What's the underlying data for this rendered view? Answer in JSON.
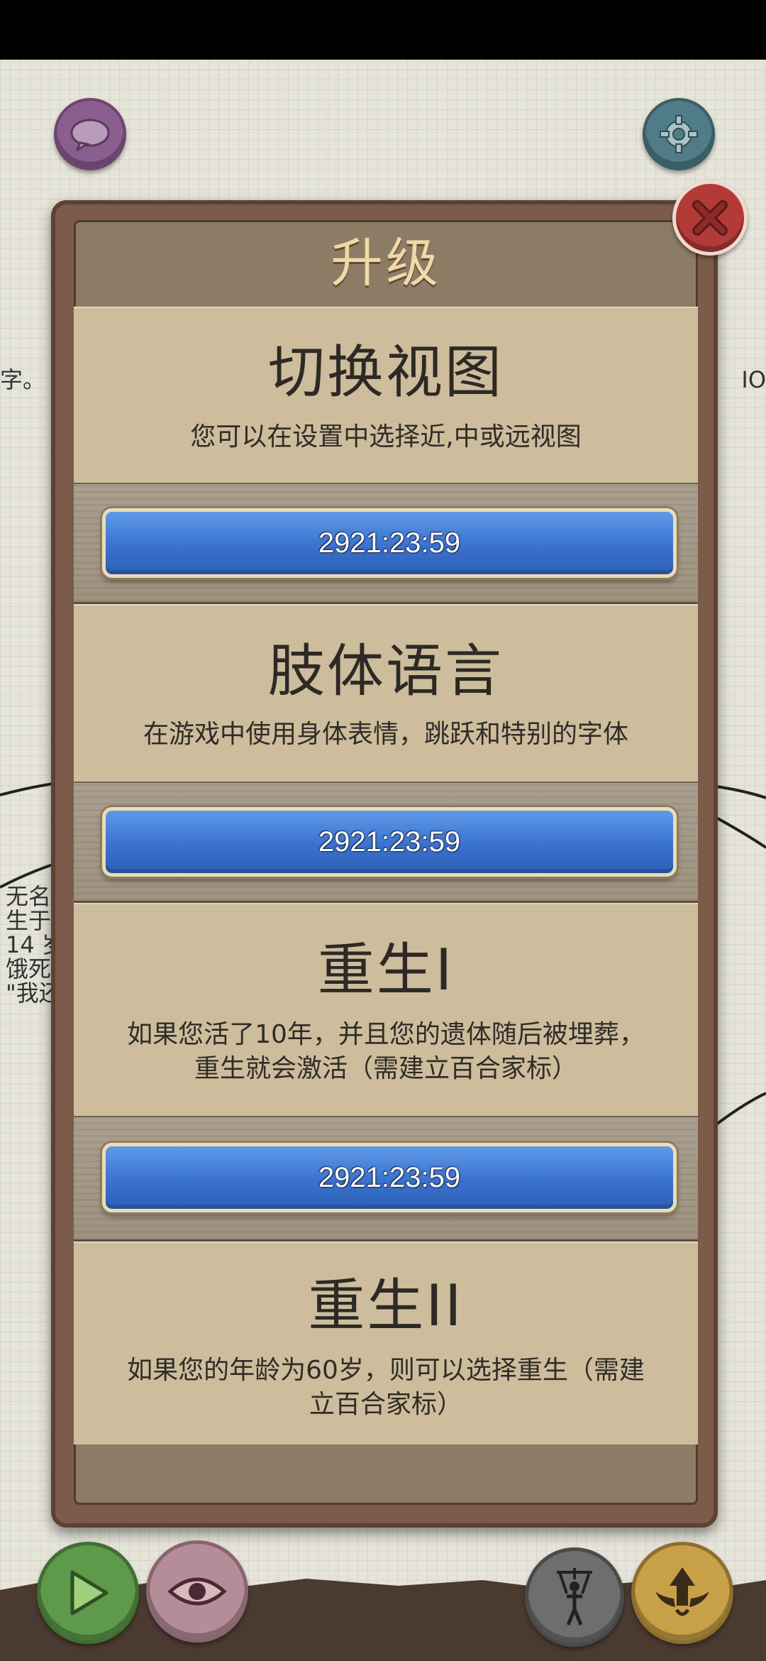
{
  "background": {
    "side_left": "字。",
    "side_right": "IO",
    "list": [
      "无名",
      "生于",
      "14 岁",
      "饿死",
      "\"我还"
    ]
  },
  "dialog": {
    "title": "升级",
    "cards": [
      {
        "title": "切换视图",
        "desc_lines": [
          "您可以在设置中选择近,中或远视图"
        ],
        "timer": "2921:23:59"
      },
      {
        "title": "肢体语言",
        "desc_lines": [
          "在游戏中使用身体表情，跳跃和特别的字体"
        ],
        "timer": "2921:23:59"
      },
      {
        "title": "重生I",
        "desc_lines": [
          "如果您活了10年，并且您的遗体随后被埋葬，",
          "重生就会激活（需建立百合家标）"
        ],
        "timer": "2921:23:59"
      },
      {
        "title": "重生II",
        "desc_lines": [
          "如果您的年龄为60岁，则可以选择重生（需建",
          "立百合家标）"
        ]
      }
    ]
  },
  "icons": {
    "chat": "chat-bubble-icon",
    "settings": "gear-icon",
    "close": "close-x-icon",
    "play": "play-triangle-icon",
    "view": "eye-icon",
    "puppet": "puppet-icon",
    "upgrade": "winged-arrow-up-icon"
  },
  "colors": {
    "timer_button": "#3a72cf",
    "title_text": "#f1d8a8",
    "card_bg": "#cdbd9c"
  }
}
